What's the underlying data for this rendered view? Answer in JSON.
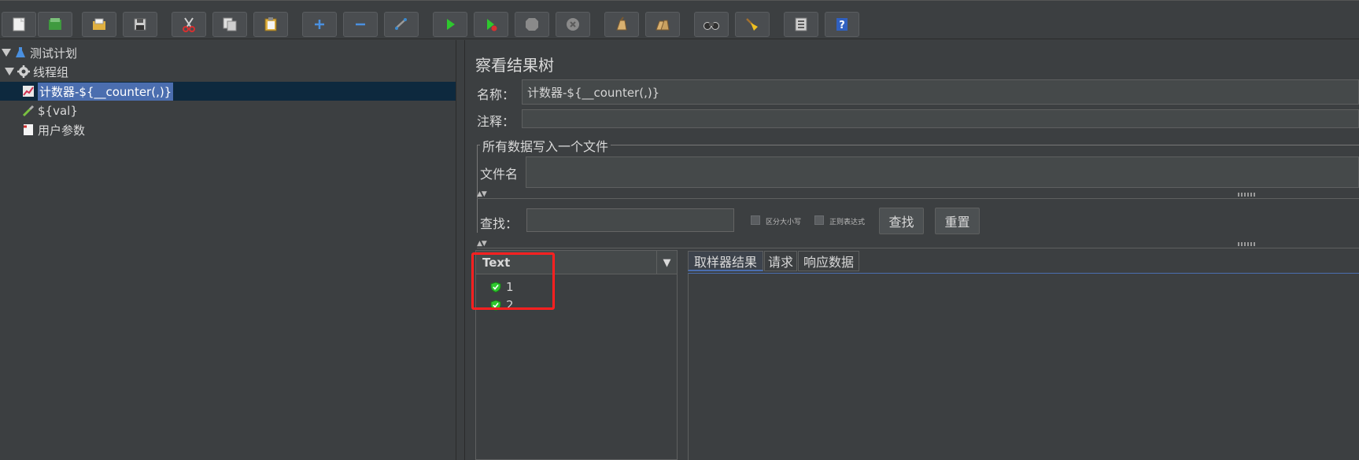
{
  "toolbar": {
    "buttons": [
      {
        "name": "new-icon",
        "color": "#f0f0f0"
      },
      {
        "name": "templates-icon",
        "color": "#3f9a3f"
      },
      {
        "name": "open-icon",
        "color": "#e0b040"
      },
      {
        "name": "save-icon",
        "color": "#d0d0d0"
      },
      {
        "name": "cut-icon",
        "color": "#d83030"
      },
      {
        "name": "copy-icon",
        "color": "#d0d0d0"
      },
      {
        "name": "paste-icon",
        "color": "#e0b040"
      },
      {
        "name": "expand-icon",
        "color": "#4a90e0"
      },
      {
        "name": "collapse-icon",
        "color": "#4a90e0"
      },
      {
        "name": "toggle-icon",
        "color": "#9a9a9a"
      },
      {
        "name": "start-icon",
        "color": "#2ec82e"
      },
      {
        "name": "start-no-pause-icon",
        "color": "#2ec82e"
      },
      {
        "name": "stop-icon",
        "color": "#8a8a8a"
      },
      {
        "name": "shutdown-icon",
        "color": "#8a8a8a"
      },
      {
        "name": "clear-icon",
        "color": "#d8b070"
      },
      {
        "name": "clear-all-icon",
        "color": "#d8b070"
      },
      {
        "name": "search-icon",
        "color": "#303030"
      },
      {
        "name": "reset-search-icon",
        "color": "#f0c020"
      },
      {
        "name": "function-helper-icon",
        "color": "#d0d0d0"
      },
      {
        "name": "help-icon",
        "color": "#3060c0"
      }
    ]
  },
  "tree": {
    "nodes": [
      {
        "label": "测试计划"
      },
      {
        "label": "线程组"
      },
      {
        "label": "计数器-${__counter(,)}"
      },
      {
        "label": "${val}"
      },
      {
        "label": "用户参数"
      }
    ]
  },
  "panel": {
    "title": "察看结果树",
    "name_label": "名称：",
    "name_value": "计数器-${__counter(,)}",
    "comment_label": "注释：",
    "comment_value": "",
    "file_group_legend": "所有数据写入一个文件",
    "filename_label": "文件名",
    "filename_value": "",
    "search_label": "查找：",
    "search_value": "",
    "case_sensitive_label": "区分大小写",
    "regex_label": "正则表达式",
    "find_button": "查找",
    "reset_button": "重置"
  },
  "results": {
    "renderer": "Text",
    "items": [
      {
        "label": "1",
        "status": "success"
      },
      {
        "label": "2",
        "status": "success"
      }
    ],
    "tabs": [
      {
        "label": "取样器结果",
        "active": true
      },
      {
        "label": "请求",
        "active": false
      },
      {
        "label": "响应数据",
        "active": false
      }
    ]
  },
  "colors": {
    "background": "#3c3f41",
    "selection": "#4b6eaf",
    "highlight_box": "#ff2020",
    "success": "#2ec82e"
  }
}
